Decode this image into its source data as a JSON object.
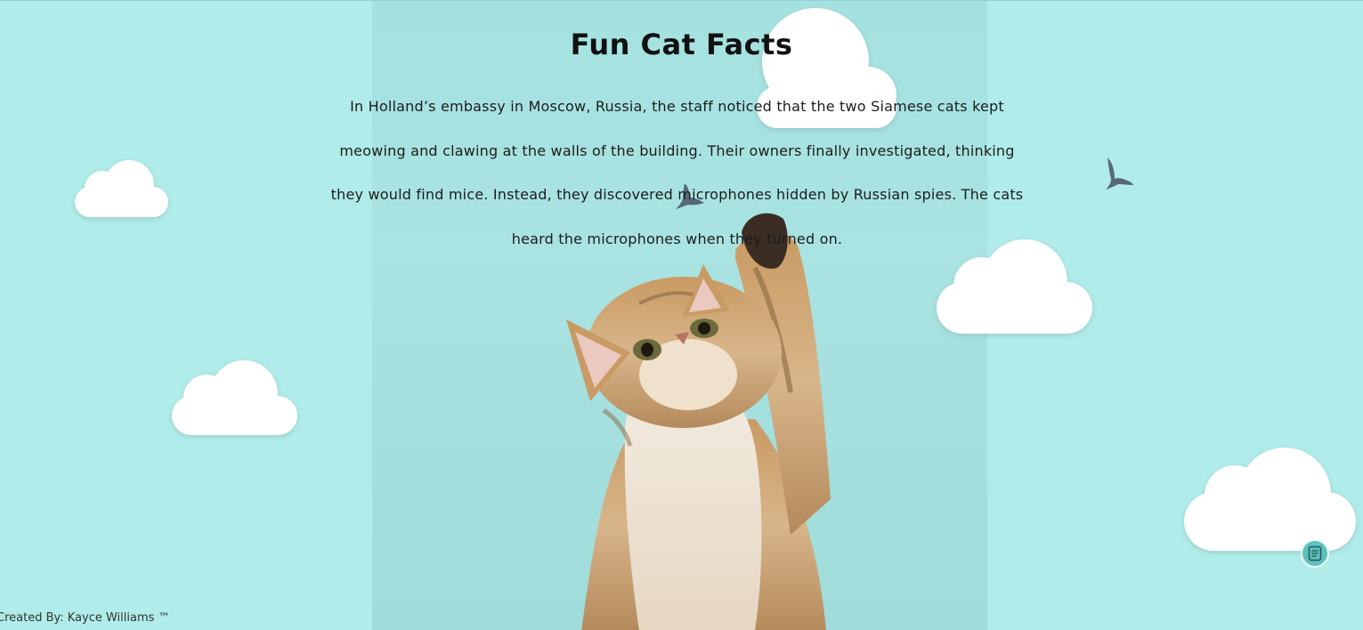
{
  "page": {
    "title": "Fun Cat Facts",
    "fact": "In Holland’s embassy in Moscow, Russia, the staff noticed that the two Siamese cats kept meowing and clawing at the walls of the building. Their owners finally investigated, thinking they would find mice. Instead, they discovered microphones hidden by Russian spies. The cats heard the microphones when they turned on.",
    "credit": "Created By: Kayce Williams ™"
  },
  "decor": {
    "main_image": "cat-reaching-up-photo",
    "clouds": 5,
    "birds": 2
  },
  "widget": {
    "icon": "notes-icon"
  },
  "colors": {
    "background": "#b0ece9",
    "text": "#111111",
    "fab": "#5fc1bd"
  }
}
